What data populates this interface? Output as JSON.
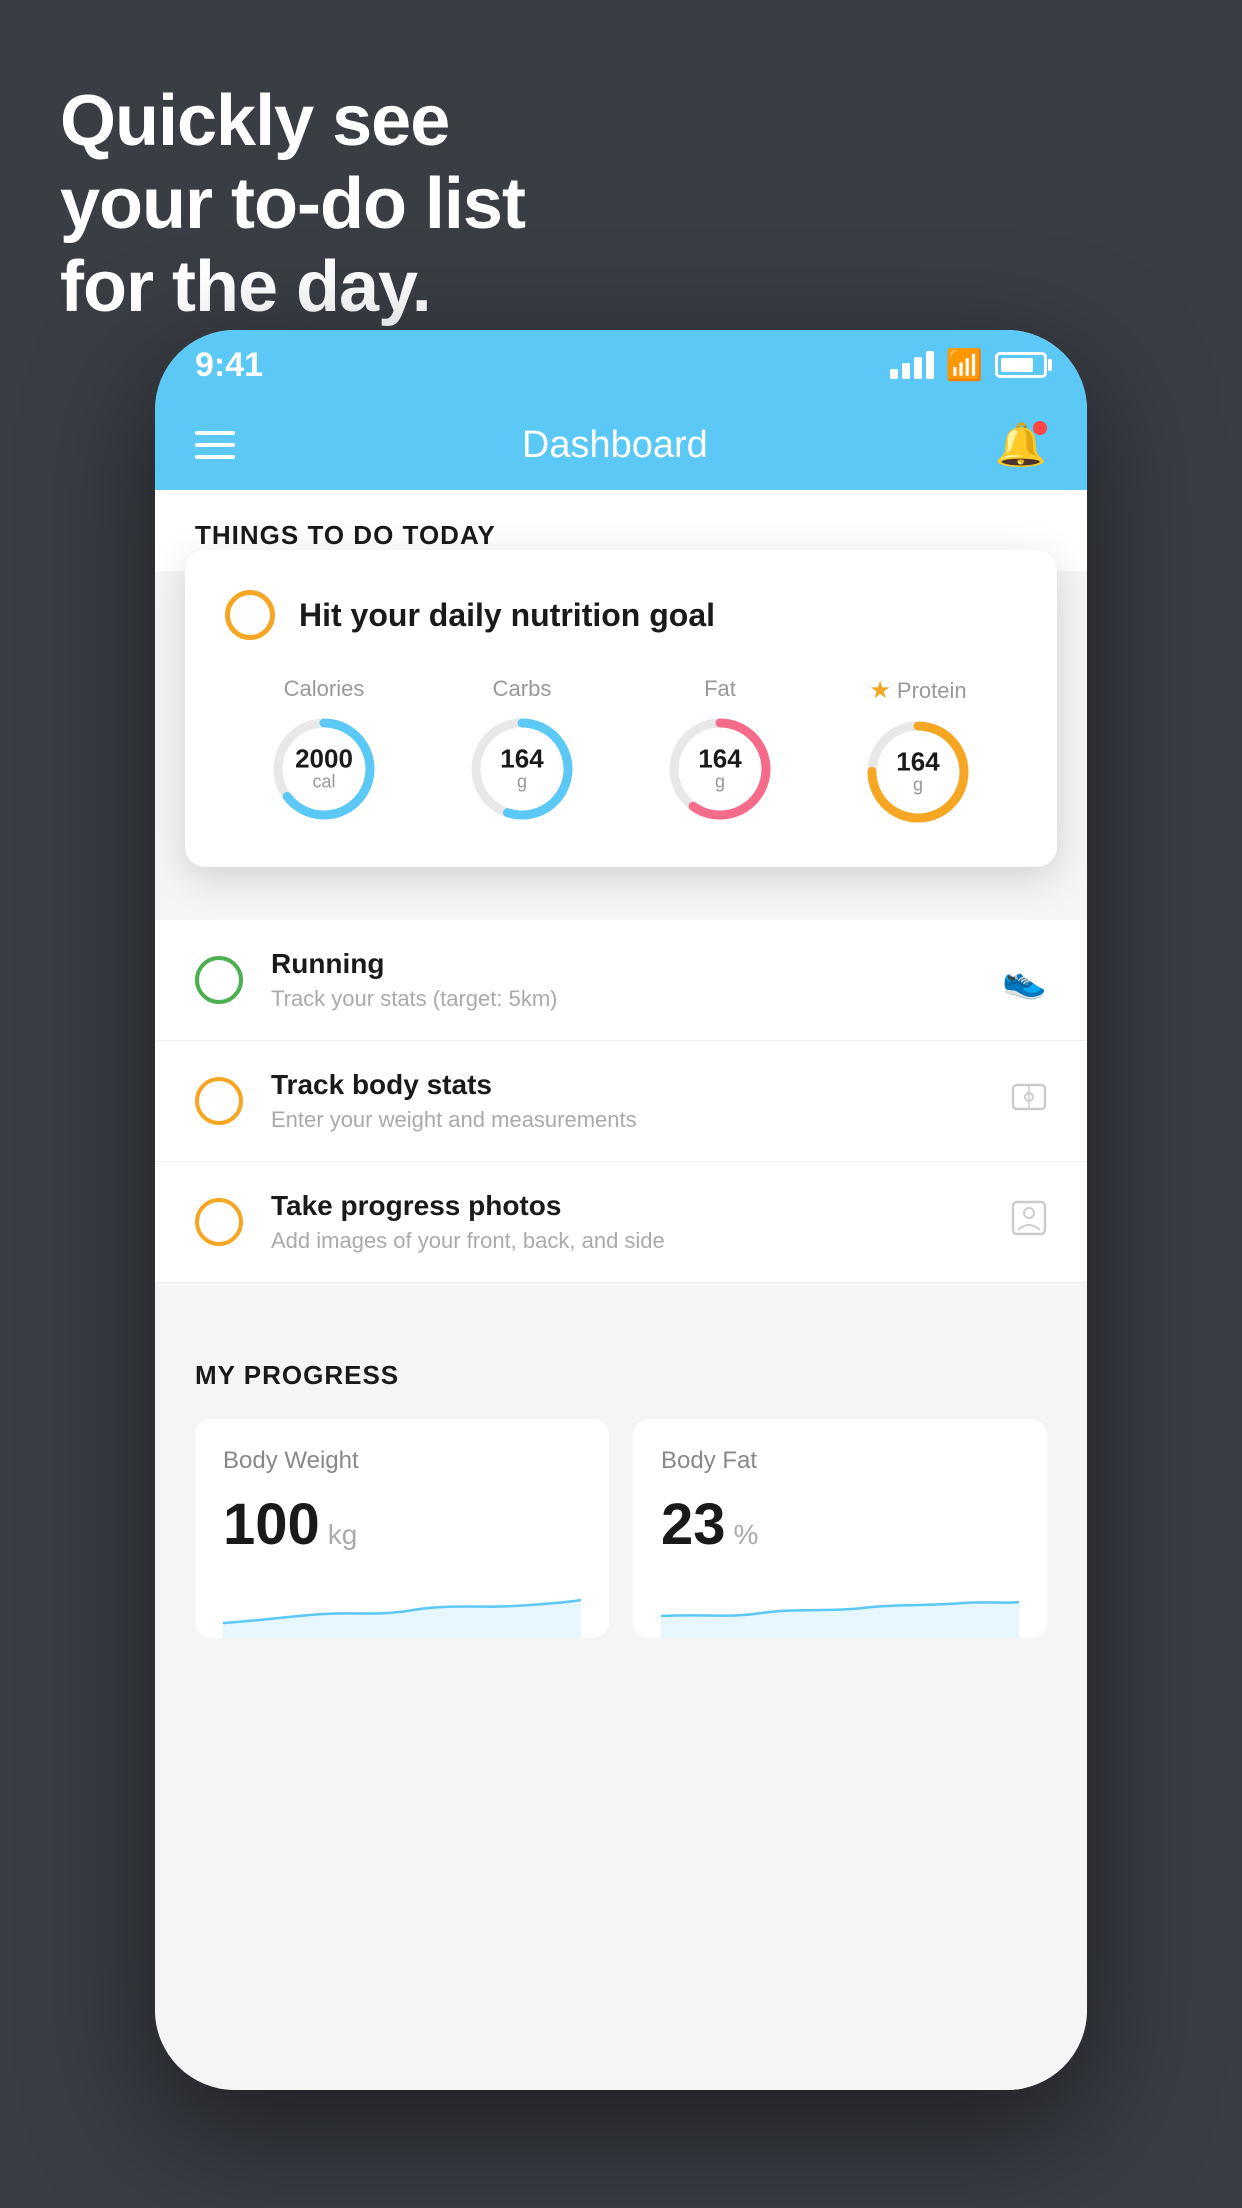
{
  "background": {
    "color": "#3a3d44"
  },
  "headline": {
    "line1": "Quickly see",
    "line2": "your to-do list",
    "line3": "for the day."
  },
  "phone": {
    "status_bar": {
      "time": "9:41",
      "signal": "signal",
      "wifi": "wifi",
      "battery": "battery"
    },
    "header": {
      "title": "Dashboard",
      "menu_icon": "hamburger",
      "bell_icon": "bell"
    },
    "things_section": {
      "title": "THINGS TO DO TODAY"
    },
    "nutrition_card": {
      "goal_label": "Hit your daily nutrition goal",
      "macros": [
        {
          "label": "Calories",
          "value": "2000",
          "unit": "cal",
          "color": "blue",
          "pct": 65
        },
        {
          "label": "Carbs",
          "value": "164",
          "unit": "g",
          "color": "blue",
          "pct": 55
        },
        {
          "label": "Fat",
          "value": "164",
          "unit": "g",
          "color": "pink",
          "pct": 60
        },
        {
          "label": "Protein",
          "value": "164",
          "unit": "g",
          "color": "yellow",
          "pct": 75,
          "starred": true
        }
      ]
    },
    "todo_items": [
      {
        "title": "Running",
        "subtitle": "Track your stats (target: 5km)",
        "circle_color": "green",
        "icon": "shoe"
      },
      {
        "title": "Track body stats",
        "subtitle": "Enter your weight and measurements",
        "circle_color": "yellow",
        "icon": "scale"
      },
      {
        "title": "Take progress photos",
        "subtitle": "Add images of your front, back, and side",
        "circle_color": "yellow",
        "icon": "person"
      }
    ],
    "progress_section": {
      "title": "MY PROGRESS",
      "cards": [
        {
          "title": "Body Weight",
          "value": "100",
          "unit": "kg"
        },
        {
          "title": "Body Fat",
          "value": "23",
          "unit": "%"
        }
      ]
    }
  }
}
